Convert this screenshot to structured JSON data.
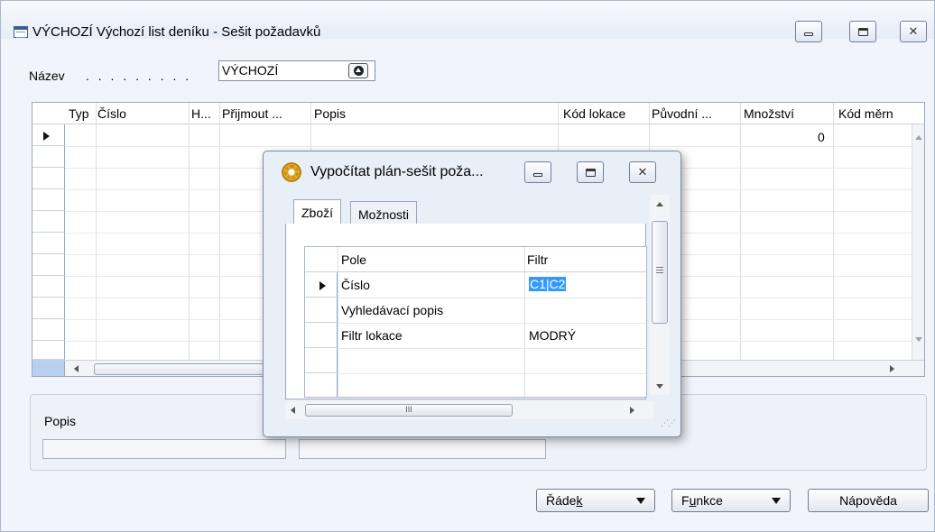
{
  "window": {
    "title": "VÝCHOZÍ Výchozí list deníku - Sešit požadavků",
    "name_label": "Název",
    "name_dots": ". . . . . . . . .",
    "name_value": "VÝCHOZÍ"
  },
  "grid": {
    "columns": [
      "Typ",
      "Číslo",
      "H...",
      "Přijmout ...",
      "Popis",
      "Kód lokace",
      "Původní ...",
      "Množství",
      "Kód měrn"
    ],
    "first_row_quantity": "0"
  },
  "panel": {
    "popis_label": "Popis"
  },
  "buttons": {
    "radek": "Řádek",
    "radek_access": "k",
    "funkce": "Funkce",
    "funkce_access": "u",
    "napoveda": "Nápověda"
  },
  "dialog": {
    "title": "Vypočítat plán-sešit poža...",
    "tabs": [
      {
        "label": "Zboží",
        "active": true
      },
      {
        "label": "Možnosti",
        "active": false
      }
    ],
    "grid_headers": {
      "field": "Pole",
      "filter": "Filtr"
    },
    "rows": [
      {
        "field": "Číslo",
        "filter": "C1|C2",
        "selected": true
      },
      {
        "field": "Vyhledávací popis",
        "filter": ""
      },
      {
        "field": "Filtr lokace",
        "filter": "MODRÝ"
      },
      {
        "field": "",
        "filter": ""
      },
      {
        "field": "",
        "filter": ""
      }
    ],
    "hscroll_glyph": "III"
  },
  "colors": {
    "window_bg": "#f1f5fb",
    "selection": "#3399ff",
    "border": "#9aa8bd"
  },
  "icons": [
    "app-window-icon",
    "minimize-icon",
    "maximize-icon",
    "close-icon",
    "lookup-up-icon",
    "row-pointer-icon",
    "gear-icon",
    "chevron-down-icon",
    "scroll-arrow-icon",
    "resize-grip-icon"
  ]
}
